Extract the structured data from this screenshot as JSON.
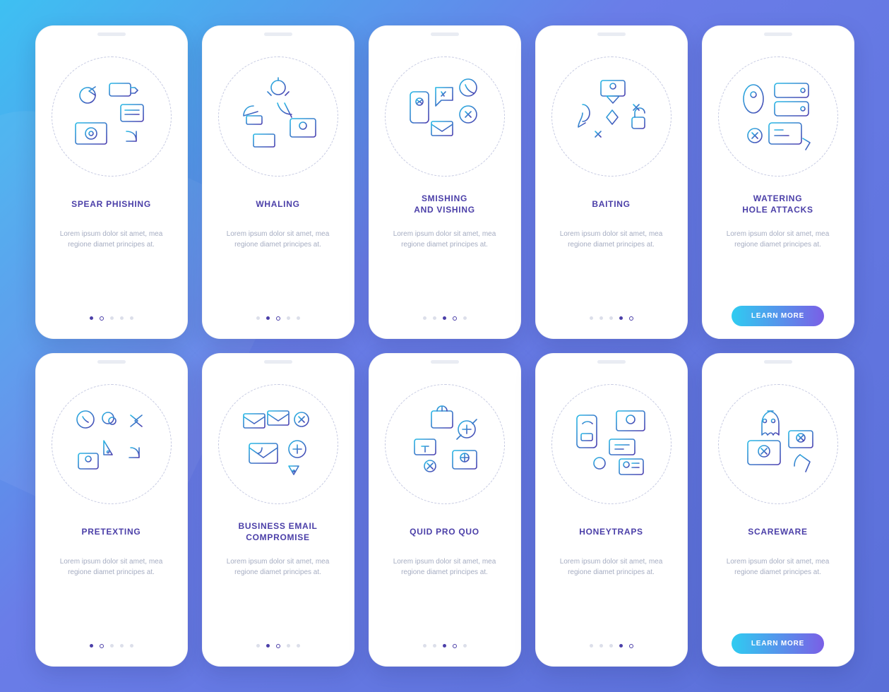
{
  "common": {
    "desc": "Lorem ipsum dolor sit amet, mea regione diamet principes at.",
    "button_label": "LEARN MORE"
  },
  "cards": [
    {
      "title": "SPEAR PHISHING",
      "icon": "target-phishing-icon",
      "active_dot": 0,
      "has_button": false
    },
    {
      "title": "WHALING",
      "icon": "whaling-icon",
      "active_dot": 1,
      "has_button": false
    },
    {
      "title": "SMISHING\nAND VISHING",
      "icon": "smishing-vishing-icon",
      "active_dot": 2,
      "has_button": false
    },
    {
      "title": "BAITING",
      "icon": "baiting-icon",
      "active_dot": 3,
      "has_button": false
    },
    {
      "title": "WATERING\nHOLE ATTACKS",
      "icon": "watering-hole-icon",
      "active_dot": 4,
      "has_button": true
    },
    {
      "title": "PRETEXTING",
      "icon": "pretexting-icon",
      "active_dot": 0,
      "has_button": false
    },
    {
      "title": "BUSINESS EMAIL\nCOMPROMISE",
      "icon": "bec-icon",
      "active_dot": 1,
      "has_button": false
    },
    {
      "title": "QUID PRO QUO",
      "icon": "quid-pro-quo-icon",
      "active_dot": 2,
      "has_button": false
    },
    {
      "title": "HONEYTRAPS",
      "icon": "honeytraps-icon",
      "active_dot": 3,
      "has_button": false
    },
    {
      "title": "SCAREWARE",
      "icon": "scareware-icon",
      "active_dot": 4,
      "has_button": true
    }
  ]
}
